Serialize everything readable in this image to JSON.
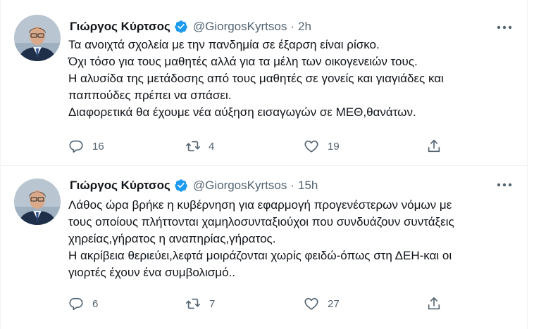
{
  "tweets": [
    {
      "author_name": "Γιώργος Κύρτσος",
      "handle": "@GiorgosKyrtsos",
      "separator": "·",
      "time": "2h",
      "lines": [
        "Τα ανοιχτά σχολεία με την πανδημία σε έξαρση είναι ρίσκο.",
        "Όχι τόσο για τους μαθητές αλλά για τα μέλη των οικογενειών τους.",
        "Η αλυσίδα της μετάδοσης από τους μαθητές σε γονείς και γιαγιάδες και",
        "παππούδες πρέπει να σπάσει.",
        "Διαφορετικά θα έχουμε νέα αύξηση εισαγωγών σε ΜΕΘ,θανάτων."
      ],
      "replies": "16",
      "retweets": "4",
      "likes": "19"
    },
    {
      "author_name": "Γιώργος Κύρτσος",
      "handle": "@GiorgosKyrtsos",
      "separator": "·",
      "time": "15h",
      "lines": [
        "Λάθος ώρα βρήκε η κυβέρνηση για εφαρμογή προγενέστερων νόμων με",
        "τους οποίους πλήττονται χαμηλοσυνταξιούχοι που συνδυάζουν συντάξεις",
        "χηρείας,γήρατος η αναπηρίας,γήρατος.",
        "Η ακρίβεια θεριεύει,λεφτά μοιράζονται χωρίς φειδώ-όπως στη ΔΕΗ-και οι",
        "γιορτές έχουν ένα συμβολισμό.."
      ],
      "replies": "6",
      "retweets": "7",
      "likes": "27"
    }
  ],
  "icons": {
    "avatar": "profile-photo",
    "verified": "verified-badge-icon",
    "more": "more-horizontal-icon",
    "reply": "reply-icon",
    "retweet": "retweet-icon",
    "like": "heart-icon",
    "share": "share-icon"
  },
  "colors": {
    "text": "#0f1419",
    "secondary": "#536471",
    "verified": "#1d9bf0",
    "divider": "#eff3f4"
  }
}
